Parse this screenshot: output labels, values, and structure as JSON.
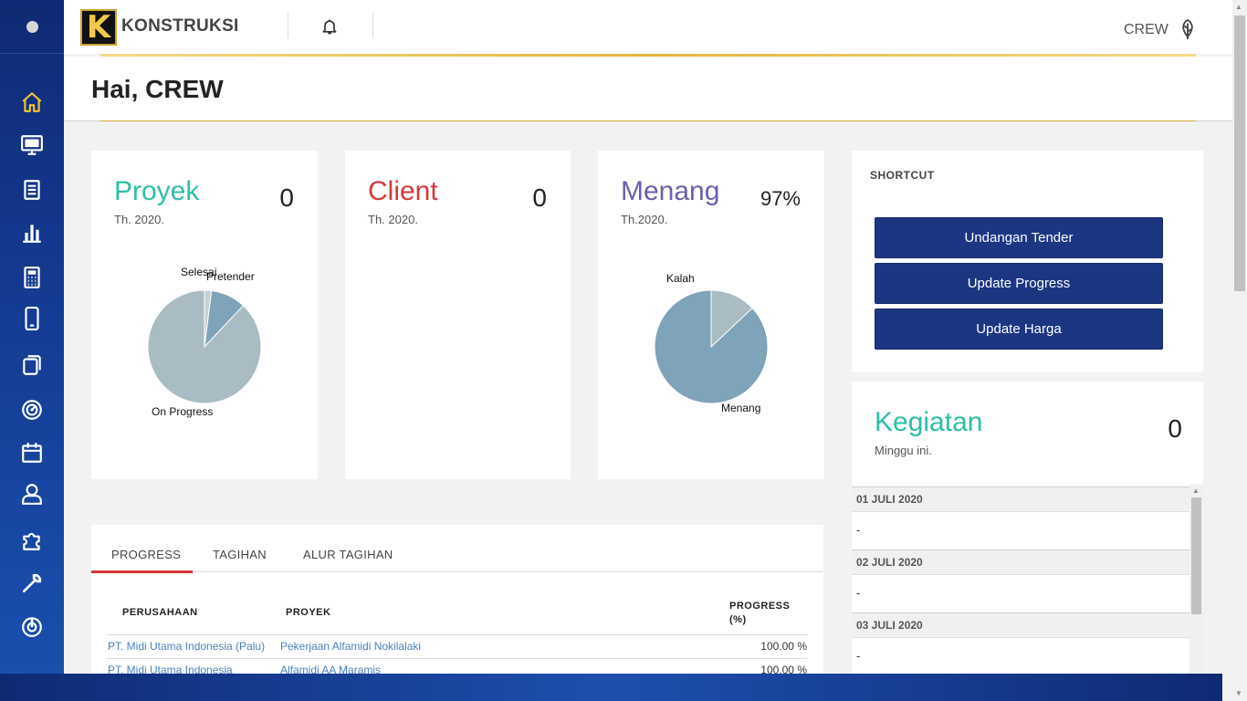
{
  "header": {
    "brand": "KONSTRUKSI",
    "logo_letter": "K",
    "user": "CREW"
  },
  "greeting": "Hai, CREW",
  "cards": {
    "proyek": {
      "title": "Proyek",
      "subtitle": "Th. 2020.",
      "value": "0",
      "color": "#2bbfa8",
      "pie": {
        "labels": [
          "Selesai",
          "Pretender",
          "On Progress"
        ],
        "values": [
          2,
          10,
          88
        ]
      }
    },
    "client": {
      "title": "Client",
      "subtitle": "Th. 2020.",
      "value": "0",
      "color": "#d6393a"
    },
    "menang": {
      "title": "Menang",
      "subtitle": "Th.2020.",
      "value": "97%",
      "color": "#6a5fab",
      "pie": {
        "labels": [
          "Kalah",
          "Menang"
        ],
        "values": [
          13,
          87
        ]
      }
    }
  },
  "shortcut": {
    "title": "SHORTCUT",
    "buttons": [
      "Undangan Tender",
      "Update Progress",
      "Update Harga"
    ]
  },
  "kegiatan": {
    "title": "Kegiatan",
    "subtitle": "Minggu ini.",
    "value": "0",
    "days": [
      {
        "date": "01 JULI 2020",
        "item": "-"
      },
      {
        "date": "02 JULI 2020",
        "item": "-"
      },
      {
        "date": "03 JULI 2020",
        "item": "-"
      }
    ]
  },
  "tabs": [
    "PROGRESS",
    "TAGIHAN",
    "ALUR TAGIHAN"
  ],
  "table": {
    "headers": {
      "perusahaan": "PERUSAHAAN",
      "proyek": "PROYEK",
      "progress_1": "PROGRESS",
      "progress_2": "(%)"
    },
    "rows": [
      {
        "perusahaan": "PT. Midi Utama Indonesia (Palu)",
        "proyek": "Pekerjaan Alfamidi Nokilalaki",
        "progress": "100.00 %"
      },
      {
        "perusahaan": "PT. Midi Utama Indonesia",
        "proyek": "Alfamidi AA Maramis",
        "progress": "100.00 %"
      }
    ]
  },
  "sidebar": {
    "icons": [
      "home-icon",
      "monitor-icon",
      "document-icon",
      "bar-chart-icon",
      "calculator-icon",
      "mobile-icon",
      "copy-icon",
      "gauge-icon",
      "calendar-icon",
      "user-icon",
      "puzzle-icon",
      "wrench-icon",
      "power-icon"
    ],
    "active_color": "#f2c230"
  }
}
